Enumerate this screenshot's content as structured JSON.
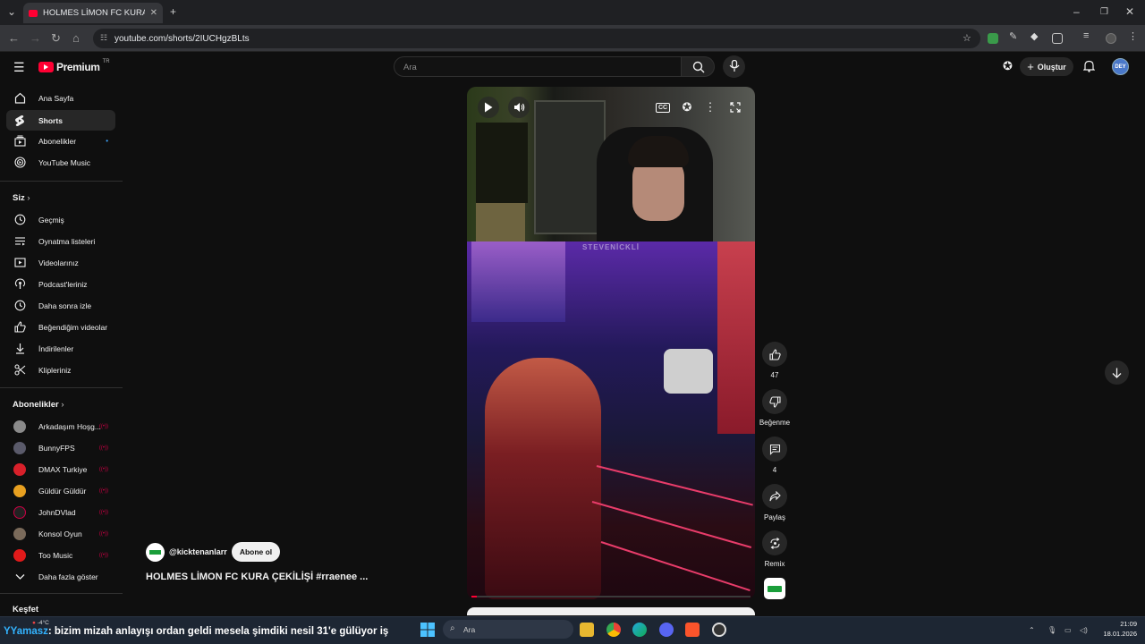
{
  "browser": {
    "tab_title": "HOLMES LİMON FC KURA ÇEKİL",
    "url": "youtube.com/shorts/2IUCHgzBLts"
  },
  "header": {
    "logo": "Premium",
    "region": "TR",
    "search_placeholder": "Ara",
    "create_label": "Oluştur",
    "avatar_text": "DEY"
  },
  "sidebar": {
    "main": [
      {
        "label": "Ana Sayfa",
        "icon": "home-icon"
      },
      {
        "label": "Shorts",
        "icon": "shorts-icon"
      },
      {
        "label": "Abonelikler",
        "icon": "subscriptions-icon"
      },
      {
        "label": "YouTube Music",
        "icon": "youtube-music-icon"
      }
    ],
    "you_header": "Siz",
    "you_items": [
      {
        "label": "Geçmiş",
        "icon": "history-icon"
      },
      {
        "label": "Oynatma listeleri",
        "icon": "playlists-icon"
      },
      {
        "label": "Videolarınız",
        "icon": "your-videos-icon"
      },
      {
        "label": "Podcast'leriniz",
        "icon": "podcast-icon"
      },
      {
        "label": "Daha sonra izle",
        "icon": "watch-later-icon"
      },
      {
        "label": "Beğendiğim videolar",
        "icon": "liked-icon"
      },
      {
        "label": "İndirilenler",
        "icon": "download-icon"
      },
      {
        "label": "Klipleriniz",
        "icon": "clips-icon"
      }
    ],
    "subs_header": "Abonelikler",
    "subscriptions": [
      {
        "label": "Arkadaşım Hoşg...",
        "color": "#8a8a8a"
      },
      {
        "label": "BunnyFPS",
        "color": "#5a5a6a"
      },
      {
        "label": "DMAX Turkiye",
        "color": "#d8202a"
      },
      {
        "label": "Güldür Güldür",
        "color": "#e8a020"
      },
      {
        "label": "JohnDVlad",
        "color": "#222222"
      },
      {
        "label": "Konsol Oyun",
        "color": "#7a6a5a"
      },
      {
        "label": "Too Music",
        "color": "#e01a1a"
      }
    ],
    "show_more": "Daha fazla göster",
    "explore_header": "Keşfet"
  },
  "short": {
    "watermark": "STEVENİCKLİ",
    "channel": "@kicktenanlarr",
    "subscribe": "Abone ol",
    "title": "HOLMES LİMON FC KURA ÇEKİLİŞİ #rraenee ...",
    "progress": 0.02,
    "actions": {
      "likes": "47",
      "dislike": "Beğenme",
      "comments": "4",
      "share": "Paylaş",
      "remix": "Remix"
    }
  },
  "taskbar": {
    "ticker_prefix": "YYamasz",
    "ticker_text": ": bizim mizah anlayışı ordan geldi mesela şimdiki nesil 31'e gülüyor iş",
    "weather": "-4°C",
    "search": "Ara",
    "time": "21:09",
    "date": "18.01.2026"
  }
}
